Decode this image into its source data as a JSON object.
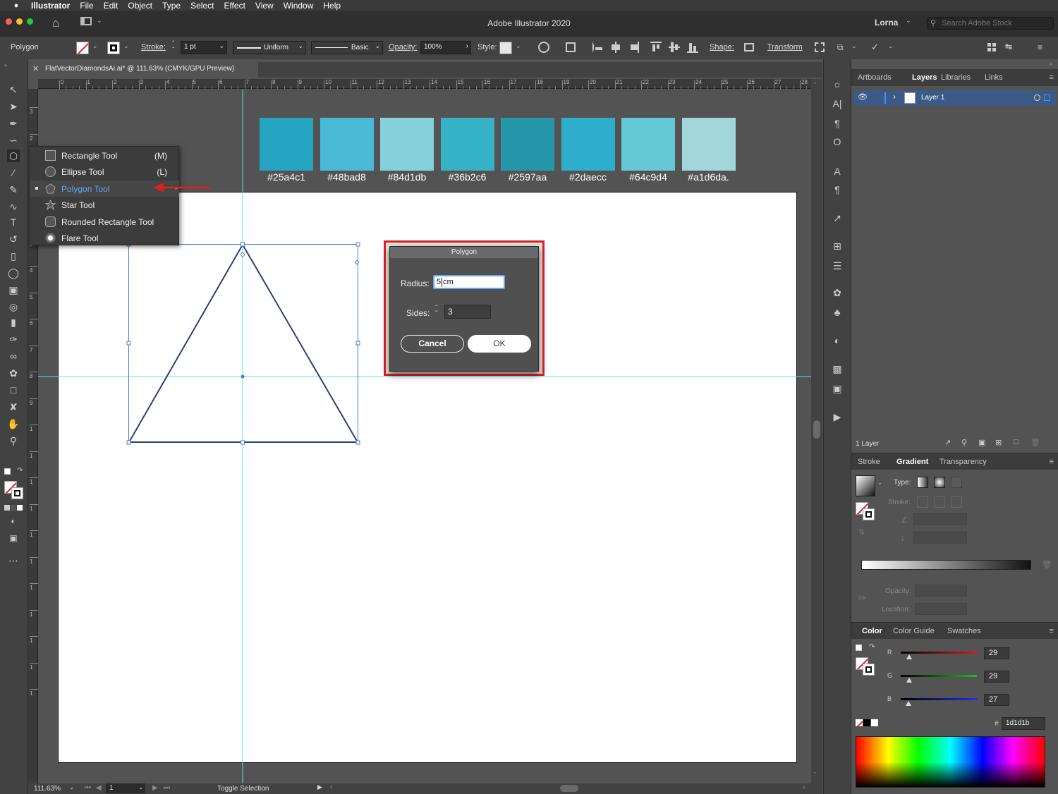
{
  "menubar": {
    "app_name": "Illustrator",
    "items": [
      "File",
      "Edit",
      "Object",
      "Type",
      "Select",
      "Effect",
      "View",
      "Window",
      "Help"
    ]
  },
  "titlebar": {
    "title": "Adobe Illustrator 2020",
    "user": "Lorna",
    "search_placeholder": "Search Adobe Stock"
  },
  "control_bar": {
    "selection_label": "Polygon",
    "stroke_label": "Stroke:",
    "stroke_weight": "1 pt",
    "profile": "Uniform",
    "brush": "Basic",
    "opacity_label": "Opacity:",
    "opacity_value": "100%",
    "style_label": "Style:",
    "shape_label": "Shape:",
    "transform_label": "Transform"
  },
  "document_tab": {
    "title": "FlatVectorDiamondsAi.ai* @ 111.63% (CMYK/GPU Preview)"
  },
  "ruler_ticks": [
    "0",
    "1",
    "2",
    "3",
    "4",
    "5",
    "6",
    "7",
    "8",
    "9",
    "10",
    "11",
    "12",
    "13",
    "14",
    "15",
    "16",
    "17",
    "18",
    "19",
    "20",
    "21",
    "22",
    "23",
    "24",
    "25",
    "26",
    "27",
    "28"
  ],
  "ruler_left_ticks": [
    "3",
    "2",
    "1",
    "1",
    "2",
    "3",
    "4",
    "5",
    "6",
    "7",
    "8",
    "9",
    "1",
    "1",
    "1",
    "1",
    "1",
    "1",
    "1",
    "1",
    "1",
    "1",
    "1"
  ],
  "swatches": [
    {
      "color": "#25a4c1",
      "label": "#25a4c1"
    },
    {
      "color": "#48bad8",
      "label": "#48bad8"
    },
    {
      "color": "#84d1db",
      "label": "#84d1db"
    },
    {
      "color": "#36b2c6",
      "label": "#36b2c6"
    },
    {
      "color": "#2597aa",
      "label": "#2597aa"
    },
    {
      "color": "#2daecc",
      "label": "#2daecc"
    },
    {
      "color": "#64c9d4",
      "label": "#64c9d4"
    },
    {
      "color": "#a1d6da",
      "label": "#a1d6da."
    }
  ],
  "flyout": {
    "items": [
      {
        "label": "Rectangle Tool",
        "shortcut": "(M)",
        "icon": "rectangle-icon",
        "selected": false
      },
      {
        "label": "Ellipse Tool",
        "shortcut": "(L)",
        "icon": "ellipse-icon",
        "selected": false
      },
      {
        "label": "Polygon Tool",
        "shortcut": "",
        "icon": "polygon-icon",
        "selected": true
      },
      {
        "label": "Star Tool",
        "shortcut": "",
        "icon": "star-icon",
        "selected": false
      },
      {
        "label": "Rounded Rectangle Tool",
        "shortcut": "",
        "icon": "rounded-rectangle-icon",
        "selected": false
      },
      {
        "label": "Flare Tool",
        "shortcut": "",
        "icon": "flare-icon",
        "selected": false
      }
    ]
  },
  "dialog": {
    "title": "Polygon",
    "radius_label": "Radius:",
    "radius_value": "5 cm",
    "sides_label": "Sides:",
    "sides_value": "3",
    "cancel_label": "Cancel",
    "ok_label": "OK"
  },
  "statusbar": {
    "zoom": "111.63%",
    "artboard_number": "1",
    "status_text": "Toggle Selection"
  },
  "layers_panel": {
    "tabs": [
      "Artboards",
      "Layers",
      "Libraries",
      "Links"
    ],
    "active_tab": "Layers",
    "layer_name": "Layer 1",
    "footer_count": "1 Layer"
  },
  "gradient_panel": {
    "tabs": [
      "Stroke",
      "Gradient",
      "Transparency"
    ],
    "active_tab": "Gradient",
    "type_label": "Type:",
    "stroke_label": "Stroke:",
    "opacity_label": "Opacity:",
    "location_label": "Location:"
  },
  "color_panel": {
    "tabs": [
      "Color",
      "Color Guide",
      "Swatches"
    ],
    "active_tab": "Color",
    "channels": [
      {
        "name": "R",
        "value": "29",
        "color": "#d02020"
      },
      {
        "name": "G",
        "value": "29",
        "color": "#20c020"
      },
      {
        "name": "B",
        "value": "27",
        "color": "#2030e0"
      }
    ],
    "hex_label": "#",
    "hex_value": "1d1d1b"
  },
  "colors": {
    "guide": "#5ee0e8",
    "selection": "#4a7ad8",
    "triangle_stroke": "#2c3f78",
    "highlight_text": "#5aa8f0",
    "annotation_red": "#e02020"
  }
}
